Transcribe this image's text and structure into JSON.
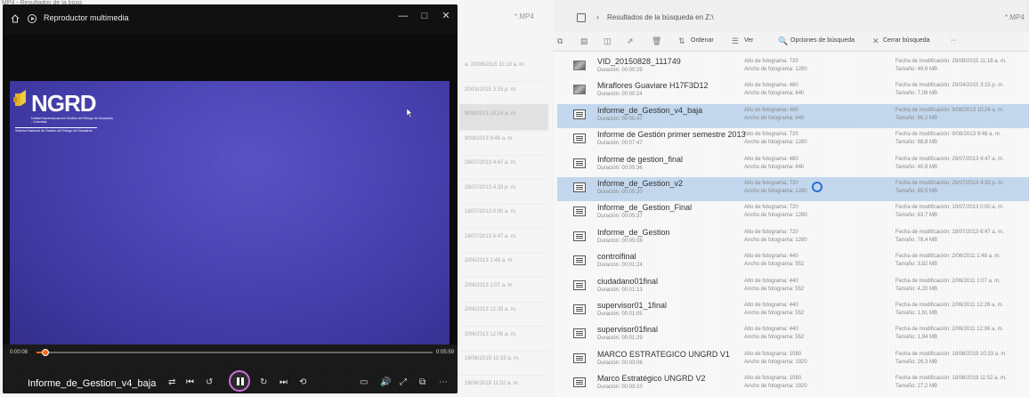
{
  "back_window": {
    "tab_title": "MP4 - Resultados de la búsq",
    "ext_label": "*.MP4",
    "row_dates": [
      "a. 20/08/2015 11:18 a. m.",
      "20/01/2015 3:15 p. m.",
      "9/08/2013 10:24 a. m.",
      "9/08/2013 9:46 a. m.",
      "26/07/2013 4:47 a. m.",
      "26/07/2013 4:33 p. m.",
      "18/07/2013 0:00 a. m.",
      "18/07/2013 6:47 a. m.",
      "2/06/2013 1:48 a. m.",
      "2/06/2013 1:07 a. m.",
      "2/06/2013 12:28 a. m.",
      "2/06/2013 12:06 a. m.",
      "18/06/2019 10:33 a. m.",
      "18/06/2019 11:52 a. m."
    ],
    "selected_row": 2
  },
  "player": {
    "window_title": "Reproductor multimedia",
    "titlebar_buttons": [
      "—",
      "□",
      "✕"
    ],
    "logo_name": "NGRD",
    "logo_sub": "Unidad Nacional para la Gestión del Riesgo de Desastres - Colombia",
    "logo_sub2": "Sistema Nacional de Gestión del Riesgo de Desastres",
    "current_time": "0:00:08",
    "total_time": "0:05:59",
    "progress_fraction": 0.022,
    "video_title": "Informe_de_Gestion_v4_baja",
    "control_glyphs": {
      "shuffle": "⇄",
      "previous": "⏮",
      "rewind": "↺",
      "forward": "↻",
      "next": "⏭",
      "repeat": "⟲",
      "subtitles": "▭",
      "volume": "🔊",
      "fullscreen": "⤢",
      "miniplayer": "⧉",
      "more": "⋯"
    },
    "accent_color": "#ff6a1a",
    "play_ring_color": "#d36de0",
    "icons": [
      "home-icon",
      "media-player-icon",
      "pause-icon",
      "mouse-cursor-icon"
    ]
  },
  "explorer": {
    "breadcrumb": "Resultados de la búsqueda en Z:\\",
    "ext_label": "*.MP4",
    "toolbar": {
      "sort": "Ordenar",
      "view": "Ver",
      "search_options": "Opciones de búsqueda",
      "close_search": "Cerrar búsqueda",
      "more": "···"
    },
    "files": [
      {
        "name": "VID_20150828_111749",
        "duration": "Duración: 00:00:29",
        "fh": "Alto de fotograma: 720",
        "fw": "Ancho de fotograma: 1280",
        "modified": "Fecha de modificación: 28/08/2015 11:18 a. m.",
        "size": "Tamaño: 49,6 MB",
        "thumb": true
      },
      {
        "name": "Miraflores Guaviare H17F3D12",
        "duration": "Duración: 00:00:24",
        "fh": "Alto de fotograma: 480",
        "fw": "Ancho de fotograma: 640",
        "modified": "Fecha de modificación: 20/04/2015 3:15 p. m.",
        "size": "Tamaño: 7,06 MB",
        "thumb": true
      },
      {
        "name": "Informe_de_Gestion_v4_baja",
        "duration": "Duración: 00:05:47",
        "fh": "Alto de fotograma: 480",
        "fw": "Ancho de fotograma: 640",
        "modified": "Fecha de modificación: 9/08/2013 10:24 a. m.",
        "size": "Tamaño: 66,2 MB",
        "selected": true
      },
      {
        "name": "Informe de Gestión primer semestre 2013",
        "duration": "Duración: 00:07:47",
        "fh": "Alto de fotograma: 720",
        "fw": "Ancho de fotograma: 1280",
        "modified": "Fecha de modificación: 9/08/2013 9:46 a. m.",
        "size": "Tamaño: 88,8 MB"
      },
      {
        "name": "Informe de gestion_final",
        "duration": "Duración: 00:05:36",
        "fh": "Alto de fotograma: 480",
        "fw": "Ancho de fotograma: 640",
        "modified": "Fecha de modificación: 26/07/2013 4:47 a. m.",
        "size": "Tamaño: 40,8 MB"
      },
      {
        "name": "Informe_de_Gestion_v2",
        "duration": "Duración: 00:05:20",
        "fh": "Alto de fotograma: 720",
        "fw": "Ancho de fotograma: 1280",
        "modified": "Fecha de modificación: 26/07/2013 4:33 p. m.",
        "size": "Tamaño: 85,5 MB",
        "selected": true
      },
      {
        "name": "Informe_de_Gestion_Final",
        "duration": "Duración: 00:05:37",
        "fh": "Alto de fotograma: 720",
        "fw": "Ancho de fotograma: 1280",
        "modified": "Fecha de modificación: 10/07/2013 0:00 a. m.",
        "size": "Tamaño: 63,7 MB"
      },
      {
        "name": "Informe_de_Gestion",
        "duration": "Duración: 00:05:08",
        "fh": "Alto de fotograma: 720",
        "fw": "Ancho de fotograma: 1280",
        "modified": "Fecha de modificación: 18/07/2013 6:47 a. m.",
        "size": "Tamaño: 78,4 MB"
      },
      {
        "name": "controlfinal",
        "duration": "Duración: 00:01:24",
        "fh": "Alto de fotograma: 440",
        "fw": "Ancho de fotograma: 552",
        "modified": "Fecha de modificación: 2/06/2011 1:48 a. m.",
        "size": "Tamaño: 3,82 MB"
      },
      {
        "name": "ciudadano01final",
        "duration": "Duración: 00:01:13",
        "fh": "Alto de fotograma: 440",
        "fw": "Ancho de fotograma: 552",
        "modified": "Fecha de modificación: 2/06/2011 1:07 a. m.",
        "size": "Tamaño: 4,20 MB"
      },
      {
        "name": "supervisor01_1final",
        "duration": "Duración: 00:01:05",
        "fh": "Alto de fotograma: 440",
        "fw": "Ancho de fotograma: 552",
        "modified": "Fecha de modificación: 2/06/2011 12:28 a. m.",
        "size": "Tamaño: 1,61 MB"
      },
      {
        "name": "supervisor01final",
        "duration": "Duración: 00:01:29",
        "fh": "Alto de fotograma: 440",
        "fw": "Ancho de fotograma: 552",
        "modified": "Fecha de modificación: 2/06/2011 12:06 a. m.",
        "size": "Tamaño: 1,94 MB"
      },
      {
        "name": "MARCO ESTRATEGICO UNGRD V1",
        "duration": "Duración: 00:03:06",
        "fh": "Alto de fotograma: 1080",
        "fw": "Ancho de fotograma: 1920",
        "modified": "Fecha de modificación: 18/06/2019 10:33 a. m.",
        "size": "Tamaño: 26,3 MB"
      },
      {
        "name": "Marco Estratégico UNGRD V2",
        "duration": "Duración: 00:03:10",
        "fh": "Alto de fotograma: 1080",
        "fw": "Ancho de fotograma: 1920",
        "modified": "Fecha de modificación: 18/06/2019 11:52 a. m.",
        "size": "Tamaño: 27,2 MB"
      }
    ],
    "selection_color": "#c4d9ef"
  }
}
